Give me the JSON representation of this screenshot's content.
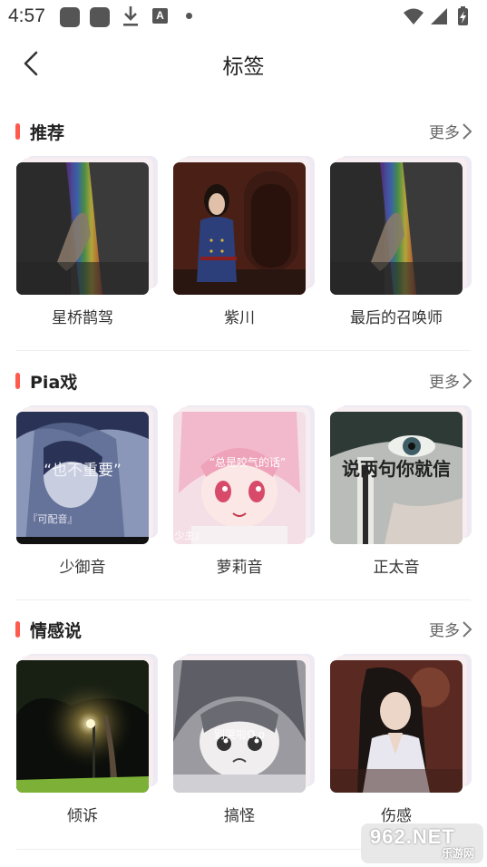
{
  "status_bar": {
    "time": "4:57",
    "a_icon": "A"
  },
  "nav": {
    "title": "标签"
  },
  "sections": [
    {
      "title": "推荐",
      "more": "更多",
      "items": [
        {
          "label": "星桥鹊驾",
          "image": "hand-rainbow"
        },
        {
          "label": "紫川",
          "image": "woman-uniform"
        },
        {
          "label": "最后的召唤师",
          "image": "hand-rainbow"
        }
      ]
    },
    {
      "title": "Pia戏",
      "more": "更多",
      "items": [
        {
          "label": "少御音",
          "image": "anime-boy-text",
          "overlay_text": "“也不重要”",
          "sub_text": "『可配音』"
        },
        {
          "label": "萝莉音",
          "image": "anime-pink-girl",
          "overlay_text": "“总是咬气的话”",
          "sub_text": "少主』"
        },
        {
          "label": "正太音",
          "image": "anime-eye",
          "overlay_text": "说两句你就信"
        }
      ]
    },
    {
      "title": "情感说",
      "more": "更多",
      "items": [
        {
          "label": "倾诉",
          "image": "night-streetlamp"
        },
        {
          "label": "搞怪",
          "image": "anime-sketch-girl",
          "overlay_text": "别哭啦O.o"
        },
        {
          "label": "伤感",
          "image": "girl-praying"
        }
      ]
    }
  ],
  "watermark": {
    "main": "962.NET",
    "sub": "乐游网"
  },
  "colors": {
    "accent": "#ff5a4e",
    "text": "#222222",
    "muted": "#666666"
  }
}
